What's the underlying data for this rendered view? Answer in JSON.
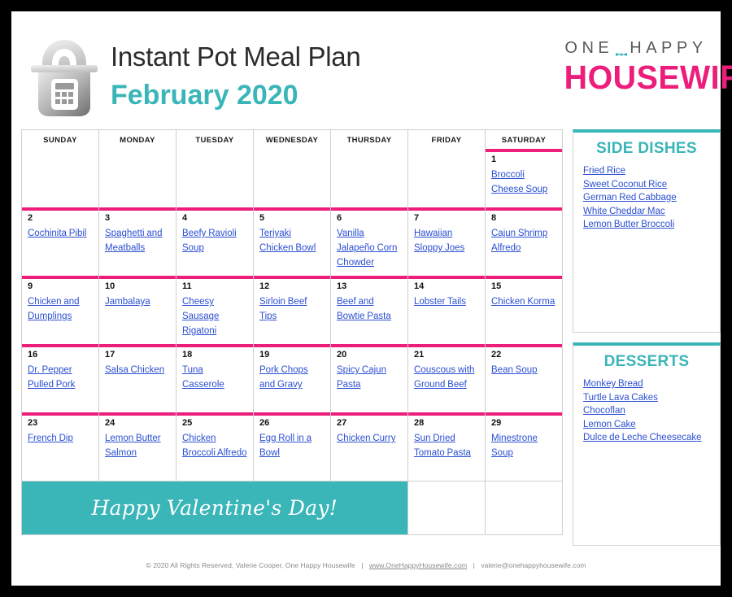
{
  "header": {
    "title": "Instant Pot Meal Plan",
    "month": "February 2020",
    "pot_icon": "instant-pot-icon",
    "logo": {
      "top": "ONE",
      "top2": "HAPPY",
      "bottom": "HOUSEWIFE",
      "deco": "bow-icon"
    }
  },
  "calendar": {
    "day_headers": [
      "SUNDAY",
      "MONDAY",
      "TUESDAY",
      "WEDNESDAY",
      "THURSDAY",
      "FRIDAY",
      "SATURDAY"
    ],
    "weeks": [
      [
        {
          "day": "",
          "meal": ""
        },
        {
          "day": "",
          "meal": ""
        },
        {
          "day": "",
          "meal": ""
        },
        {
          "day": "",
          "meal": ""
        },
        {
          "day": "",
          "meal": ""
        },
        {
          "day": "",
          "meal": ""
        },
        {
          "day": "1",
          "meal": "Broccoli Cheese Soup"
        }
      ],
      [
        {
          "day": "2",
          "meal": "Cochinita Pibil"
        },
        {
          "day": "3",
          "meal": "Spaghetti and Meatballs"
        },
        {
          "day": "4",
          "meal": "Beefy Ravioli Soup"
        },
        {
          "day": "5",
          "meal": "Teriyaki Chicken Bowl"
        },
        {
          "day": "6",
          "meal": "Vanilla Jalapeño Corn Chowder"
        },
        {
          "day": "7",
          "meal": "Hawaiian Sloppy Joes"
        },
        {
          "day": "8",
          "meal": "Cajun Shrimp Alfredo"
        }
      ],
      [
        {
          "day": "9",
          "meal": "Chicken and Dumplings"
        },
        {
          "day": "10",
          "meal": "Jambalaya"
        },
        {
          "day": "11",
          "meal": "Cheesy Sausage Rigatoni"
        },
        {
          "day": "12",
          "meal": "Sirloin Beef Tips"
        },
        {
          "day": "13",
          "meal": "Beef and Bowtie Pasta"
        },
        {
          "day": "14",
          "meal": "Lobster Tails"
        },
        {
          "day": "15",
          "meal": "Chicken Korma"
        }
      ],
      [
        {
          "day": "16",
          "meal": "Dr. Pepper Pulled Pork"
        },
        {
          "day": "17",
          "meal": "Salsa Chicken"
        },
        {
          "day": "18",
          "meal": "Tuna Casserole"
        },
        {
          "day": "19",
          "meal": "Pork Chops and Gravy"
        },
        {
          "day": "20",
          "meal": "Spicy Cajun Pasta"
        },
        {
          "day": "21",
          "meal": "Couscous with Ground Beef"
        },
        {
          "day": "22",
          "meal": "Bean Soup"
        }
      ],
      [
        {
          "day": "23",
          "meal": "French Dip"
        },
        {
          "day": "24",
          "meal": "Lemon Butter Salmon"
        },
        {
          "day": "25",
          "meal": "Chicken Broccoli Alfredo"
        },
        {
          "day": "26",
          "meal": "Egg Roll in a Bowl"
        },
        {
          "day": "27",
          "meal": "Chicken Curry"
        },
        {
          "day": "28",
          "meal": "Sun Dried Tomato Pasta"
        },
        {
          "day": "29",
          "meal": "Minestrone Soup"
        }
      ]
    ],
    "banner": "Happy Valentine's Day!"
  },
  "side_dishes": {
    "title": "SIDE DISHES",
    "items": [
      "Fried Rice",
      "Sweet Coconut Rice",
      "German Red Cabbage",
      "White Cheddar Mac",
      "Lemon Butter Broccoli"
    ]
  },
  "desserts": {
    "title": "DESSERTS",
    "items": [
      "Monkey Bread",
      "Turtle Lava Cakes",
      "Chocoflan",
      "Lemon Cake",
      "Dulce de Leche Cheesecake"
    ]
  },
  "footer": {
    "copyright": "© 2020 All Rights Reserved, Valerie Cooper, One Happy Housewife",
    "website": "www.OneHappyHousewife.com",
    "email": "valerie@onehappyhousewife.com",
    "separator": "|"
  },
  "colors": {
    "pink": "#ec1d7b",
    "teal": "#3ab5b8",
    "link": "#2b4fd1",
    "background": "#000000"
  }
}
